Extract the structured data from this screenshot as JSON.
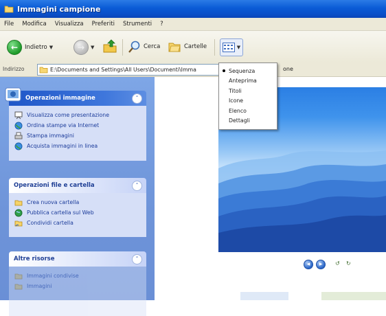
{
  "window": {
    "title": "Immagini campione"
  },
  "menubar": {
    "items": [
      "File",
      "Modifica",
      "Visualizza",
      "Preferiti",
      "Strumenti",
      "?"
    ]
  },
  "toolbar": {
    "back_label": "Indietro",
    "search_label": "Cerca",
    "folders_label": "Cartelle"
  },
  "address": {
    "label": "Indirizzo",
    "value": "E:\\Documents and Settings\\All Users\\Documenti\\Imma",
    "tail": "one"
  },
  "view_menu": {
    "items": [
      "Sequenza",
      "Anteprima",
      "Titoli",
      "Icone",
      "Elenco",
      "Dettagli"
    ],
    "selected": "Sequenza"
  },
  "tasks_images": {
    "title": "Operazioni immagine",
    "items": [
      "Visualizza come presentazione",
      "Ordina stampe via Internet",
      "Stampa immagini",
      "Acquista immagini in linea"
    ]
  },
  "tasks_files": {
    "title": "Operazioni file e cartella",
    "items": [
      "Crea nuova cartella",
      "Pubblica cartella sul Web",
      "Condividi cartella"
    ]
  },
  "other_places": {
    "title": "Altre risorse",
    "items": [
      "Immagini condivise",
      "Immagini"
    ]
  },
  "colors": {
    "titlebar": "#0a5bd6",
    "taskpane": "#6e94d9",
    "panel_body": "#d6dff7",
    "link": "#1b3b9a"
  }
}
